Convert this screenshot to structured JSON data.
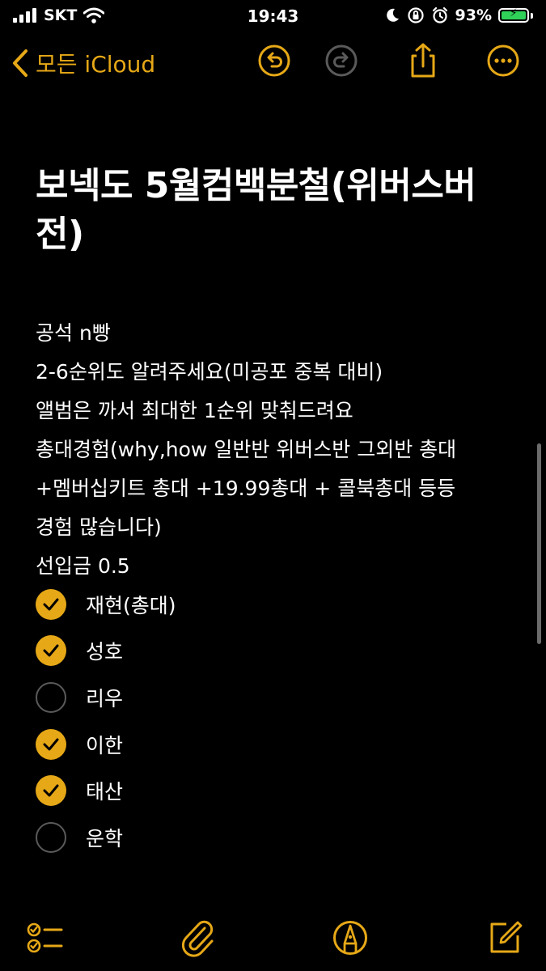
{
  "status_bar": {
    "carrier": "SKT",
    "time": "19:43",
    "battery_percent": "93%",
    "battery_level": 0.93
  },
  "nav": {
    "back_label": "모든 iCloud"
  },
  "note": {
    "title": "보넥도 5월컴백분철(위버스버전)",
    "title_lines": [
      "보넥도 5월컴백분철(위버스버",
      "전)"
    ],
    "body_lines": [
      "공석 n빵",
      "2-6순위도 알려주세요(미공포 중복 대비)",
      "앨범은 까서 최대한 1순위 맞춰드려요",
      "총대경험(why,how 일반반 위버스반 그외반 총대",
      "+멤버십키트 총대 +19.99총대 + 콜북총대 등등",
      "경험 많습니다)",
      "선입금 0.5"
    ],
    "checklist": [
      {
        "label": "재현(총대)",
        "checked": true
      },
      {
        "label": "성호",
        "checked": true
      },
      {
        "label": "리우",
        "checked": false
      },
      {
        "label": "이한",
        "checked": true
      },
      {
        "label": "태산",
        "checked": true
      },
      {
        "label": "운학",
        "checked": false
      }
    ]
  },
  "colors": {
    "accent": "#e6a817",
    "background": "#000000",
    "text": "#ffffff"
  }
}
